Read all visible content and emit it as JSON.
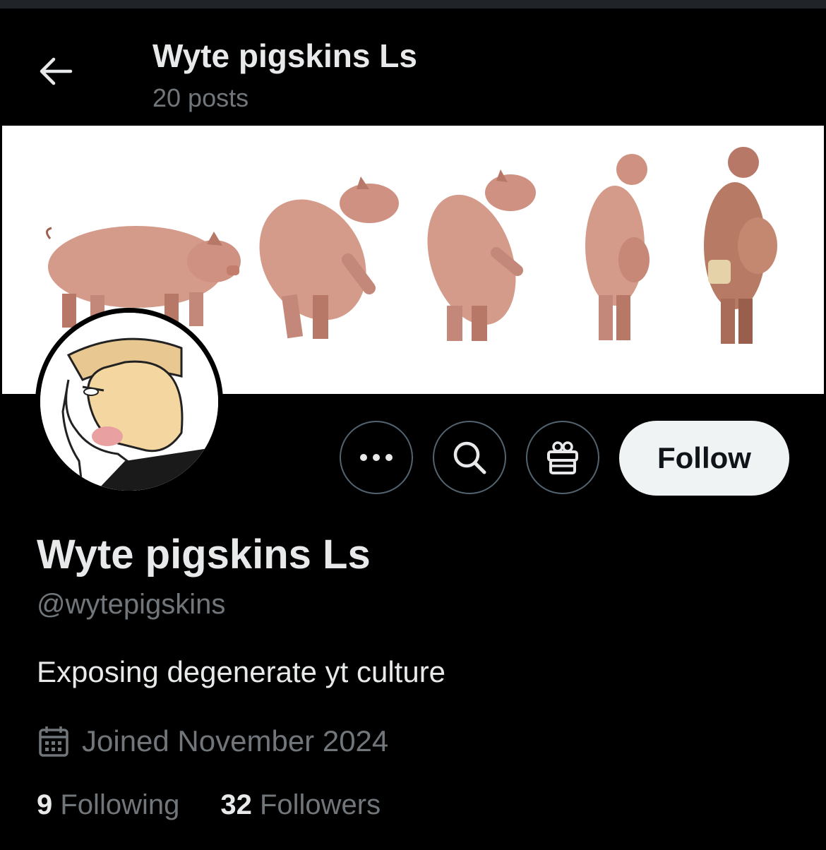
{
  "header": {
    "title": "Wyte pigskins Ls",
    "subtitle": "20 posts",
    "back_icon": "arrow-left-icon"
  },
  "banner": {
    "description_icon": "pig-to-man-evolution-image"
  },
  "profile": {
    "display_name": "Wyte pigskins Ls",
    "handle": "@wytepigskins",
    "bio": "Exposing degenerate yt culture",
    "joined": "Joined November 2024",
    "following_count": "9",
    "following_label": "Following",
    "followers_count": "32",
    "followers_label": "Followers"
  },
  "actions": {
    "more_icon": "more-icon",
    "search_icon": "search-icon",
    "gift_icon": "gift-icon",
    "follow_label": "Follow"
  },
  "colors": {
    "background": "#000000",
    "primary_text": "#e7e9ea",
    "secondary_text": "#71767b",
    "border": "#536471",
    "follow_bg": "#eff3f4"
  }
}
